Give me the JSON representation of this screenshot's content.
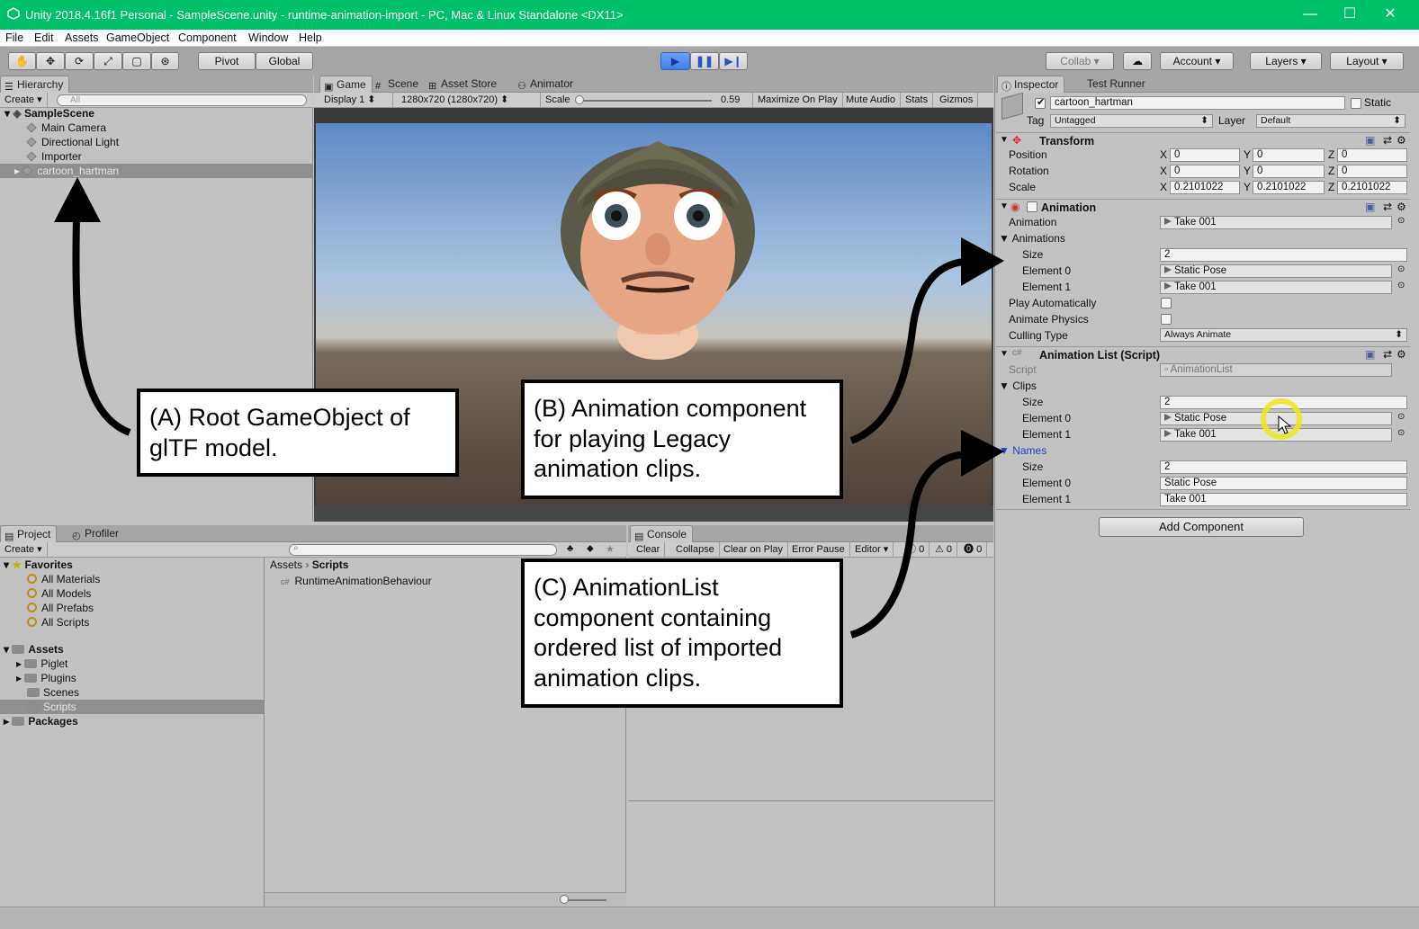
{
  "window": {
    "title": "Unity 2018.4.16f1 Personal - SampleScene.unity - runtime-animation-import - PC, Mac & Linux Standalone <DX11>",
    "controls": {
      "minimize": "—",
      "maximize": "☐",
      "close": "✕"
    },
    "accent": "#00c16a"
  },
  "menu": [
    "File",
    "Edit",
    "Assets",
    "GameObject",
    "Component",
    "Window",
    "Help"
  ],
  "toolbar": {
    "pivot": "Pivot",
    "global": "Global",
    "collab": "Collab",
    "account": "Account",
    "layers": "Layers",
    "layout": "Layout"
  },
  "hierarchy": {
    "tab": "Hierarchy",
    "create": "Create",
    "search_placeholder": "All",
    "scene": "SampleScene",
    "items": [
      "Main Camera",
      "Directional Light",
      "Importer",
      "cartoon_hartman"
    ]
  },
  "game": {
    "tabs": [
      "Game",
      "Scene",
      "Asset Store",
      "Animator"
    ],
    "display": "Display 1",
    "resolution": "1280x720 (1280x720)",
    "scale_label": "Scale",
    "scale_value": "0.59",
    "buttons": [
      "Maximize On Play",
      "Mute Audio",
      "Stats",
      "Gizmos"
    ]
  },
  "inspector": {
    "tabs": [
      "Inspector",
      "Test Runner"
    ],
    "object_name": "cartoon_hartman",
    "static_label": "Static",
    "tag_label": "Tag",
    "tag_value": "Untagged",
    "layer_label": "Layer",
    "layer_value": "Default",
    "transform": {
      "title": "Transform",
      "position_label": "Position",
      "position": [
        "0",
        "0",
        "0"
      ],
      "rotation_label": "Rotation",
      "rotation": [
        "0",
        "0",
        "0"
      ],
      "scale_label": "Scale",
      "scale": [
        "0.2101022",
        "0.2101022",
        "0.2101022"
      ],
      "axes": [
        "X",
        "Y",
        "Z"
      ]
    },
    "animation": {
      "title": "Animation",
      "animation_label": "Animation",
      "animation_value": "Take 001",
      "animations_label": "Animations",
      "size_label": "Size",
      "size_value": "2",
      "element0_label": "Element 0",
      "element0_value": "Static Pose",
      "element1_label": "Element 1",
      "element1_value": "Take 001",
      "play_auto_label": "Play Automatically",
      "animate_physics_label": "Animate Physics",
      "culling_label": "Culling Type",
      "culling_value": "Always Animate"
    },
    "animation_list": {
      "title": "Animation List (Script)",
      "script_label": "Script",
      "script_value": "AnimationList",
      "clips_label": "Clips",
      "clips_size": "2",
      "clip0": "Static Pose",
      "clip1": "Take 001",
      "names_label": "Names",
      "names_size": "2",
      "name0": "Static Pose",
      "name1": "Take 001",
      "size_label": "Size",
      "element0_label": "Element 0",
      "element1_label": "Element 1"
    },
    "add_component": "Add Component"
  },
  "project": {
    "tabs": [
      "Project",
      "Profiler"
    ],
    "create": "Create",
    "favorites_label": "Favorites",
    "favorites": [
      "All Materials",
      "All Models",
      "All Prefabs",
      "All Scripts"
    ],
    "assets_label": "Assets",
    "assets": [
      "Piglet",
      "Plugins",
      "Scenes",
      "Scripts"
    ],
    "packages_label": "Packages",
    "breadcrumb": [
      "Assets",
      "Scripts"
    ],
    "file": "RuntimeAnimationBehaviour"
  },
  "console": {
    "tab": "Console",
    "buttons": [
      "Clear",
      "Collapse",
      "Clear on Play",
      "Error Pause",
      "Editor"
    ],
    "counts": [
      "0",
      "0",
      "0"
    ]
  },
  "callouts": {
    "a": "(A) Root GameObject of glTF model.",
    "b": "(B) Animation component for playing Legacy animation clips.",
    "c": "(C) AnimationList component containing ordered list of imported animation clips."
  }
}
